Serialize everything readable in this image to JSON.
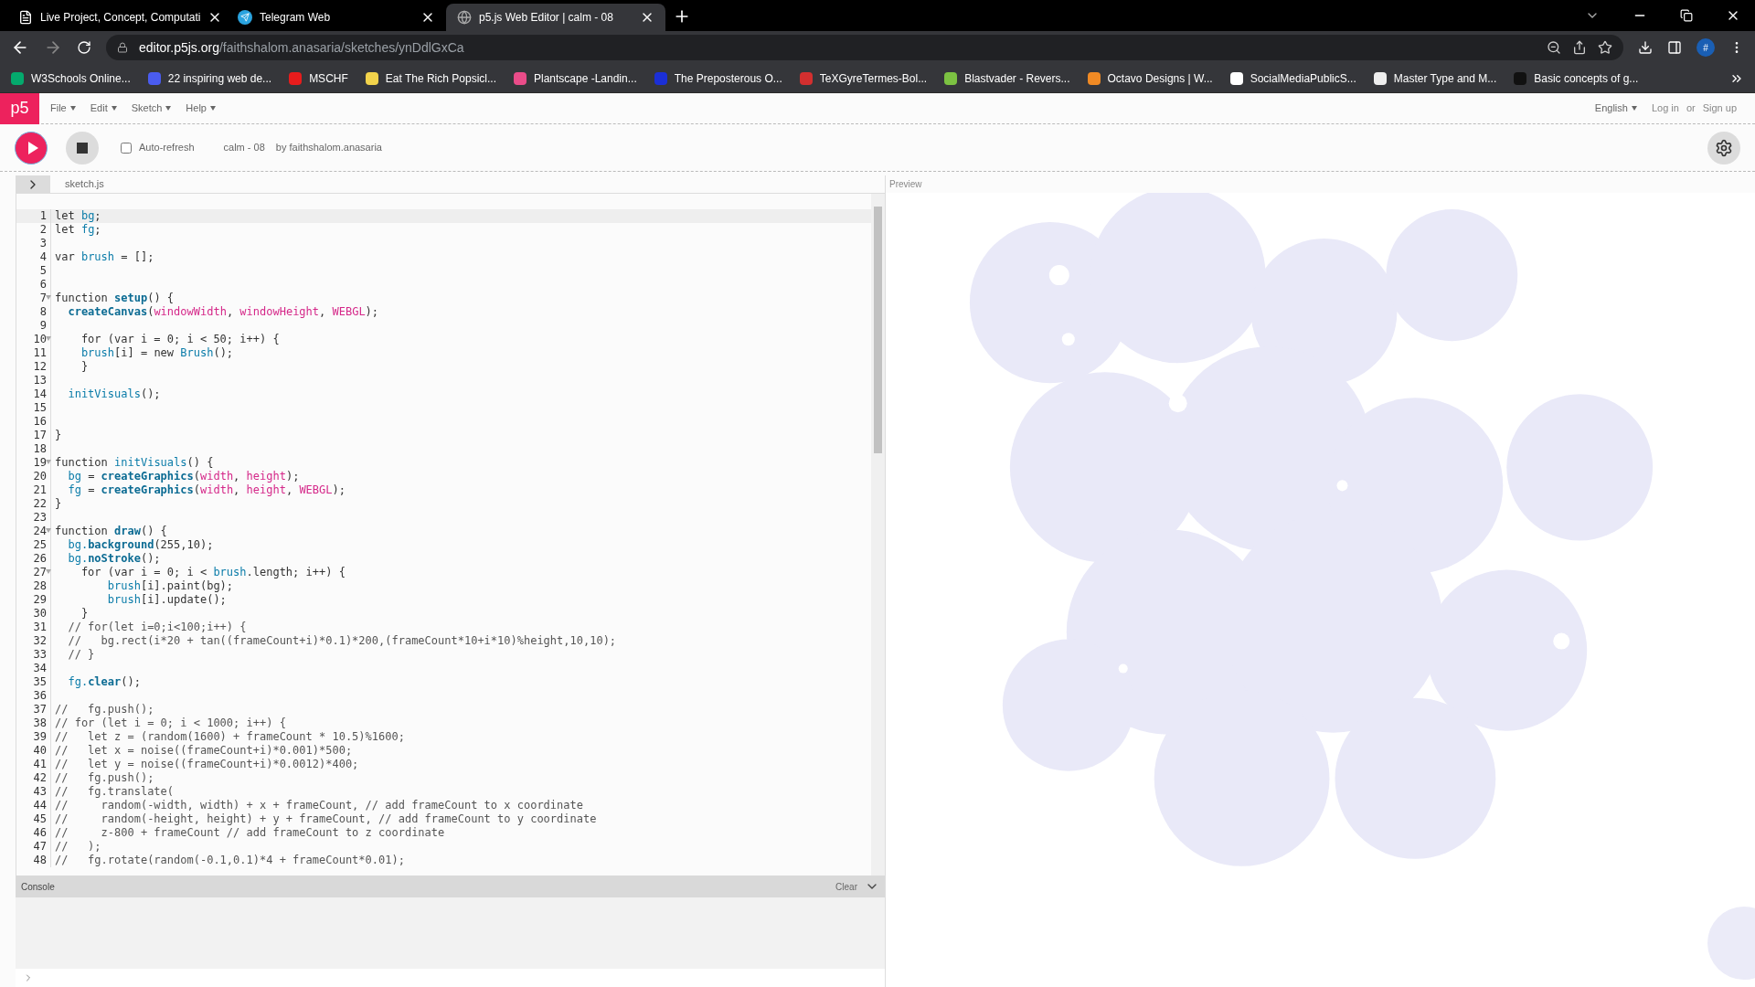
{
  "browser": {
    "tabs": [
      {
        "title": "Live Project, Concept, Computati",
        "selected": false,
        "kind": "page"
      },
      {
        "title": "Telegram Web",
        "selected": false,
        "kind": "telegram"
      },
      {
        "title": "p5.js Web Editor | calm - 08",
        "selected": true,
        "kind": "globe"
      }
    ],
    "address": {
      "host": "editor.p5js.org",
      "path": "/faithshalom.anasaria/sketches/ynDdlGxCa"
    },
    "profile": "#",
    "bookmarks": [
      {
        "title": "W3Schools Online...",
        "color": "#04aa6d"
      },
      {
        "title": "22 inspiring web de...",
        "color": "#4a5cf0"
      },
      {
        "title": "MSCHF",
        "color": "#e81c1c"
      },
      {
        "title": "Eat The Rich Popsicl...",
        "color": "#f2d34b"
      },
      {
        "title": "Plantscape -Landin...",
        "color": "#ea4c89"
      },
      {
        "title": "The Preposterous O...",
        "color": "#1b2fd6"
      },
      {
        "title": "TeXGyreTermes-Bol...",
        "color": "#d32f2f"
      },
      {
        "title": "Blastvader - Revers...",
        "color": "#7cc242"
      },
      {
        "title": "Octavo Designs | W...",
        "color": "#f08a24"
      },
      {
        "title": "SocialMediaPublicS...",
        "color": "#ffffff"
      },
      {
        "title": "Master Type and M...",
        "color": "#eeeeee"
      },
      {
        "title": "Basic concepts of g...",
        "color": "#111111"
      }
    ]
  },
  "editor": {
    "logo": "p5",
    "menus": [
      "File",
      "Edit",
      "Sketch",
      "Help"
    ],
    "language": "English",
    "login": "Log in",
    "or": "or",
    "signup": "Sign up",
    "auto_refresh": {
      "label": "Auto-refresh",
      "checked": false
    },
    "sketch_name": "calm - 08",
    "author": "by faithshalom.anasaria",
    "file_name": "sketch.js",
    "preview_label": "Preview",
    "console": {
      "title": "Console",
      "clear": "Clear"
    },
    "lines": [
      {
        "number": "1",
        "active": true,
        "fold": false,
        "tokens": [
          {
            "text": "let ",
            "kind": "t"
          },
          {
            "text": "bg",
            "kind": "v"
          },
          {
            "text": ";",
            "kind": "t"
          }
        ]
      },
      {
        "number": "2",
        "active": false,
        "fold": false,
        "tokens": [
          {
            "text": "let ",
            "kind": "t"
          },
          {
            "text": "fg",
            "kind": "v"
          },
          {
            "text": ";",
            "kind": "t"
          }
        ]
      },
      {
        "number": "3",
        "active": false,
        "fold": false
      },
      {
        "number": "4",
        "active": false,
        "fold": false,
        "tokens": [
          {
            "text": "var ",
            "kind": "t"
          },
          {
            "text": "brush",
            "kind": "v"
          },
          {
            "text": " = [];",
            "kind": "t"
          }
        ]
      },
      {
        "number": "5",
        "active": false,
        "fold": false
      },
      {
        "number": "6",
        "active": false,
        "fold": false
      },
      {
        "number": "7",
        "active": false,
        "fold": true,
        "tokens": [
          {
            "text": "function ",
            "kind": "t"
          },
          {
            "text": "setup",
            "kind": "f"
          },
          {
            "text": "() {",
            "kind": "t"
          }
        ]
      },
      {
        "number": "8",
        "active": false,
        "fold": false,
        "tokens": [
          {
            "text": "  createCanvas",
            "kind": "f"
          },
          {
            "text": "(",
            "kind": "t"
          },
          {
            "text": "windowWidth",
            "kind": "c"
          },
          {
            "text": ", ",
            "kind": "t"
          },
          {
            "text": "windowHeight",
            "kind": "c"
          },
          {
            "text": ", ",
            "kind": "t"
          },
          {
            "text": "WEBGL",
            "kind": "c"
          },
          {
            "text": ");",
            "kind": "t"
          }
        ]
      },
      {
        "number": "9",
        "active": false,
        "fold": false
      },
      {
        "number": "10",
        "active": false,
        "fold": true,
        "tokens": [
          {
            "text": "    for (var i = 0; i < 50; i++) {",
            "kind": "t"
          }
        ]
      },
      {
        "number": "11",
        "active": false,
        "fold": false,
        "tokens": [
          {
            "text": "    brush",
            "kind": "v"
          },
          {
            "text": "[i] = new ",
            "kind": "t"
          },
          {
            "text": "Brush",
            "kind": "v"
          },
          {
            "text": "();",
            "kind": "t"
          }
        ]
      },
      {
        "number": "12",
        "active": false,
        "fold": false,
        "tokens": [
          {
            "text": "    }",
            "kind": "t"
          }
        ]
      },
      {
        "number": "13",
        "active": false,
        "fold": false
      },
      {
        "number": "14",
        "active": false,
        "fold": false,
        "tokens": [
          {
            "text": "  initVisuals",
            "kind": "v"
          },
          {
            "text": "();",
            "kind": "t"
          }
        ]
      },
      {
        "number": "15",
        "active": false,
        "fold": false
      },
      {
        "number": "16",
        "active": false,
        "fold": false
      },
      {
        "number": "17",
        "active": false,
        "fold": false,
        "tokens": [
          {
            "text": "}",
            "kind": "t"
          }
        ]
      },
      {
        "number": "18",
        "active": false,
        "fold": false
      },
      {
        "number": "19",
        "active": false,
        "fold": true,
        "tokens": [
          {
            "text": "function ",
            "kind": "t"
          },
          {
            "text": "initVisuals",
            "kind": "v"
          },
          {
            "text": "() {",
            "kind": "t"
          }
        ]
      },
      {
        "number": "20",
        "active": false,
        "fold": false,
        "tokens": [
          {
            "text": "  bg",
            "kind": "v"
          },
          {
            "text": " = ",
            "kind": "t"
          },
          {
            "text": "createGraphics",
            "kind": "f"
          },
          {
            "text": "(",
            "kind": "t"
          },
          {
            "text": "width",
            "kind": "c"
          },
          {
            "text": ", ",
            "kind": "t"
          },
          {
            "text": "height",
            "kind": "c"
          },
          {
            "text": ");",
            "kind": "t"
          }
        ]
      },
      {
        "number": "21",
        "active": false,
        "fold": false,
        "tokens": [
          {
            "text": "  fg",
            "kind": "v"
          },
          {
            "text": " = ",
            "kind": "t"
          },
          {
            "text": "createGraphics",
            "kind": "f"
          },
          {
            "text": "(",
            "kind": "t"
          },
          {
            "text": "width",
            "kind": "c"
          },
          {
            "text": ", ",
            "kind": "t"
          },
          {
            "text": "height",
            "kind": "c"
          },
          {
            "text": ", ",
            "kind": "t"
          },
          {
            "text": "WEBGL",
            "kind": "c"
          },
          {
            "text": ");",
            "kind": "t"
          }
        ]
      },
      {
        "number": "22",
        "active": false,
        "fold": false,
        "tokens": [
          {
            "text": "}",
            "kind": "t"
          }
        ]
      },
      {
        "number": "23",
        "active": false,
        "fold": false
      },
      {
        "number": "24",
        "active": false,
        "fold": true,
        "tokens": [
          {
            "text": "function ",
            "kind": "t"
          },
          {
            "text": "draw",
            "kind": "f"
          },
          {
            "text": "() {",
            "kind": "t"
          }
        ]
      },
      {
        "number": "25",
        "active": false,
        "fold": false,
        "tokens": [
          {
            "text": "  bg.",
            "kind": "v"
          },
          {
            "text": "background",
            "kind": "f"
          },
          {
            "text": "(255,10);",
            "kind": "t"
          }
        ]
      },
      {
        "number": "26",
        "active": false,
        "fold": false,
        "tokens": [
          {
            "text": "  bg.",
            "kind": "v"
          },
          {
            "text": "noStroke",
            "kind": "f"
          },
          {
            "text": "();",
            "kind": "t"
          }
        ]
      },
      {
        "number": "27",
        "active": false,
        "fold": true,
        "tokens": [
          {
            "text": "    for (var i = 0; i < ",
            "kind": "t"
          },
          {
            "text": "brush",
            "kind": "v"
          },
          {
            "text": ".length; i++) {",
            "kind": "t"
          }
        ]
      },
      {
        "number": "28",
        "active": false,
        "fold": false,
        "tokens": [
          {
            "text": "        brush",
            "kind": "v"
          },
          {
            "text": "[i].paint(bg);",
            "kind": "t"
          }
        ]
      },
      {
        "number": "29",
        "active": false,
        "fold": false,
        "tokens": [
          {
            "text": "        brush",
            "kind": "v"
          },
          {
            "text": "[i].update();",
            "kind": "t"
          }
        ]
      },
      {
        "number": "30",
        "active": false,
        "fold": false,
        "tokens": [
          {
            "text": "    }",
            "kind": "t"
          }
        ]
      },
      {
        "number": "31",
        "active": false,
        "fold": false,
        "tokens": [
          {
            "text": "  // for(let i=0;i<100;i++) {",
            "kind": "m"
          }
        ]
      },
      {
        "number": "32",
        "active": false,
        "fold": false,
        "tokens": [
          {
            "text": "  //   bg.rect(i*20 + tan((frameCount+i)*0.1)*200,(frameCount*10+i*10)%height,10,10);",
            "kind": "m"
          }
        ]
      },
      {
        "number": "33",
        "active": false,
        "fold": false,
        "tokens": [
          {
            "text": "  // }",
            "kind": "m"
          }
        ]
      },
      {
        "number": "34",
        "active": false,
        "fold": false
      },
      {
        "number": "35",
        "active": false,
        "fold": false,
        "tokens": [
          {
            "text": "  fg.",
            "kind": "v"
          },
          {
            "text": "clear",
            "kind": "f"
          },
          {
            "text": "();",
            "kind": "t"
          }
        ]
      },
      {
        "number": "36",
        "active": false,
        "fold": false
      },
      {
        "number": "37",
        "active": false,
        "fold": false,
        "tokens": [
          {
            "text": "//   fg.push();",
            "kind": "m"
          }
        ]
      },
      {
        "number": "38",
        "active": false,
        "fold": false,
        "tokens": [
          {
            "text": "// for (let i = 0; i < 1000; i++) {",
            "kind": "m"
          }
        ]
      },
      {
        "number": "39",
        "active": false,
        "fold": false,
        "tokens": [
          {
            "text": "//   let z = (random(1600) + frameCount * 10.5)%1600;",
            "kind": "m"
          }
        ]
      },
      {
        "number": "40",
        "active": false,
        "fold": false,
        "tokens": [
          {
            "text": "//   let x = noise((frameCount+i)*0.001)*500;",
            "kind": "m"
          }
        ]
      },
      {
        "number": "41",
        "active": false,
        "fold": false,
        "tokens": [
          {
            "text": "//   let y = noise((frameCount+i)*0.0012)*400;",
            "kind": "m"
          }
        ]
      },
      {
        "number": "42",
        "active": false,
        "fold": false,
        "tokens": [
          {
            "text": "//   fg.push();",
            "kind": "m"
          }
        ]
      },
      {
        "number": "43",
        "active": false,
        "fold": false,
        "tokens": [
          {
            "text": "//   fg.translate(",
            "kind": "m"
          }
        ]
      },
      {
        "number": "44",
        "active": false,
        "fold": false,
        "tokens": [
          {
            "text": "//     random(-width, width) + x + frameCount, // add frameCount to x coordinate",
            "kind": "m"
          }
        ]
      },
      {
        "number": "45",
        "active": false,
        "fold": false,
        "tokens": [
          {
            "text": "//     random(-height, height) + y + frameCount, // add frameCount to y coordinate",
            "kind": "m"
          }
        ]
      },
      {
        "number": "46",
        "active": false,
        "fold": false,
        "tokens": [
          {
            "text": "//     z-800 + frameCount // add frameCount to z coordinate",
            "kind": "m"
          }
        ]
      },
      {
        "number": "47",
        "active": false,
        "fold": false,
        "tokens": [
          {
            "text": "//   );",
            "kind": "m"
          }
        ]
      },
      {
        "number": "48",
        "active": false,
        "fold": false,
        "tokens": [
          {
            "text": "//   fg.rotate(random(-0.1,0.1)*4 + frameCount*0.01);",
            "kind": "m"
          }
        ]
      }
    ]
  }
}
